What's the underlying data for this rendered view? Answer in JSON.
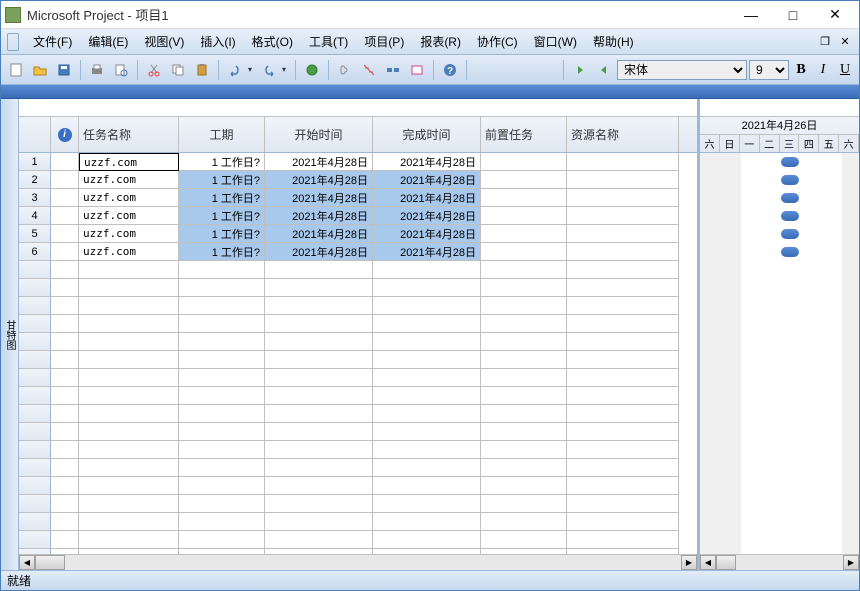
{
  "title": "Microsoft Project - 项目1",
  "menu": {
    "file": "文件(F)",
    "edit": "编辑(E)",
    "view": "视图(V)",
    "insert": "插入(I)",
    "format": "格式(O)",
    "tools": "工具(T)",
    "project": "项目(P)",
    "report": "报表(R)",
    "collab": "协作(C)",
    "window": "窗口(W)",
    "help": "帮助(H)"
  },
  "font": {
    "name": "宋体",
    "size": "9"
  },
  "columns": {
    "name": "任务名称",
    "duration": "工期",
    "start": "开始时间",
    "finish": "完成时间",
    "pred": "前置任务",
    "resource": "资源名称"
  },
  "widths": {
    "name": 100,
    "duration": 86,
    "start": 108,
    "finish": 108,
    "pred": 86,
    "resource": 112
  },
  "rows": [
    {
      "id": 1,
      "name": "uzzf.com",
      "duration": "1 工作日?",
      "start": "2021年4月28日",
      "finish": "2021年4月28日",
      "sel": false
    },
    {
      "id": 2,
      "name": "uzzf.com",
      "duration": "1 工作日?",
      "start": "2021年4月28日",
      "finish": "2021年4月28日",
      "sel": true
    },
    {
      "id": 3,
      "name": "uzzf.com",
      "duration": "1 工作日?",
      "start": "2021年4月28日",
      "finish": "2021年4月28日",
      "sel": true
    },
    {
      "id": 4,
      "name": "uzzf.com",
      "duration": "1 工作日?",
      "start": "2021年4月28日",
      "finish": "2021年4月28日",
      "sel": true
    },
    {
      "id": 5,
      "name": "uzzf.com",
      "duration": "1 工作日?",
      "start": "2021年4月28日",
      "finish": "2021年4月28日",
      "sel": true
    },
    {
      "id": 6,
      "name": "uzzf.com",
      "duration": "1 工作日?",
      "start": "2021年4月28日",
      "finish": "2021年4月28日",
      "sel": true
    }
  ],
  "gantt": {
    "week": "2021年4月26日",
    "days": [
      "六",
      "日",
      "一",
      "二",
      "三",
      "四",
      "五",
      "六"
    ]
  },
  "status": "就绪",
  "sidestrip": "甘特图",
  "icons": {
    "new": "new",
    "open": "open",
    "save": "save",
    "print": "print",
    "preview": "preview",
    "cut": "cut",
    "copy": "copy",
    "paste": "paste",
    "undo": "undo",
    "redo": "redo",
    "link": "link",
    "unlink": "unlink",
    "split": "split",
    "info": "info",
    "help": "help",
    "arrow": "arrow"
  }
}
